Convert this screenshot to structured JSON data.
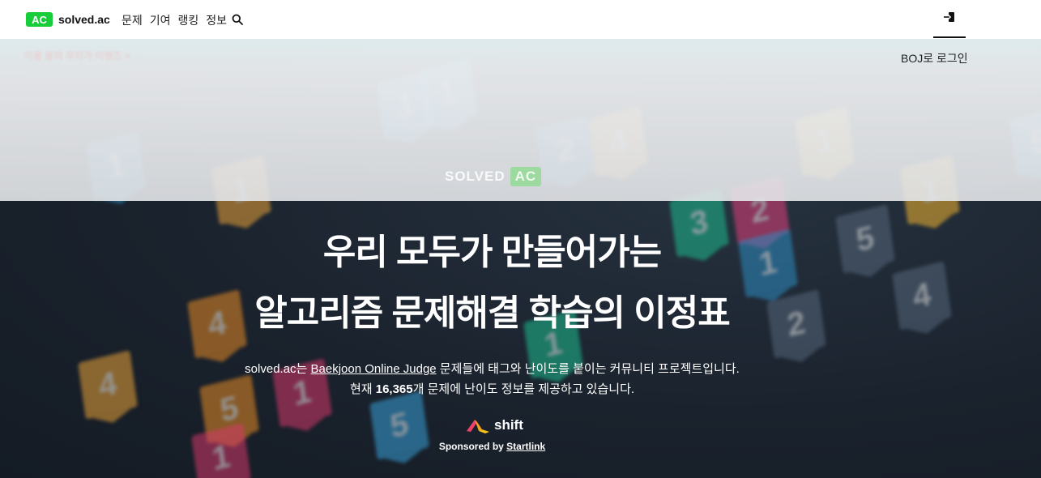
{
  "header": {
    "logo_badge": "AC",
    "logo_text": "solved.ac",
    "nav": [
      "문제",
      "기여",
      "랭킹",
      "정보"
    ],
    "login_label": "BOJ로 로그인"
  },
  "hero": {
    "headline_1": "우리 모두가 만들어가는",
    "headline_2": "알고리즘 문제해결 학습의 이정표",
    "desc_prefix": "solved.ac는 ",
    "desc_link": "Baekjoon Online Judge",
    "desc_suffix": " 문제들에 태그와 난이도를 붙이는 커뮤니티 프로젝트입니다.",
    "count_prefix": "현재 ",
    "count_value": "16,365",
    "count_suffix": "개 문제에 난이도 정보를 제공하고 있습니다.",
    "sponsor_brand": "shift",
    "sponsor_prefix": "Sponsored by ",
    "sponsor_link": "Startlink"
  },
  "background": {
    "logo_word": "SOLVED",
    "logo_box": "AC",
    "hint": "이용 등의 우리가 이렌즈 >"
  },
  "colors": {
    "accent": "#17ce3a",
    "dark_bg": "#17202b"
  }
}
